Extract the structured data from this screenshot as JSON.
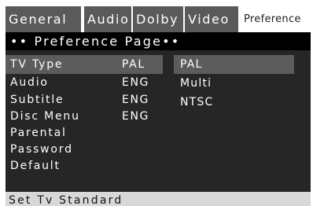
{
  "tabs": [
    {
      "label": "General"
    },
    {
      "label": "Audio"
    },
    {
      "label": "Dolby"
    },
    {
      "label": "Video"
    },
    {
      "label": "Preference"
    }
  ],
  "page_title": "•• Preference Page••",
  "menu": [
    {
      "label": "TV Type",
      "value": "PAL"
    },
    {
      "label": "Audio",
      "value": "ENG"
    },
    {
      "label": "Subtitle",
      "value": "ENG"
    },
    {
      "label": "Disc Menu",
      "value": "ENG"
    },
    {
      "label": "Parental",
      "value": ""
    },
    {
      "label": "Password",
      "value": ""
    },
    {
      "label": "Default",
      "value": ""
    }
  ],
  "options": [
    "PAL",
    "Multi",
    "NTSC"
  ],
  "status": "Set Tv Standard",
  "colors": {
    "tab_bg": "#5a5a5a",
    "panel_bg": "#262626",
    "title_bar_bg": "#000000",
    "highlight": "#5c5c5c",
    "status_bg": "#d8d8d8"
  }
}
